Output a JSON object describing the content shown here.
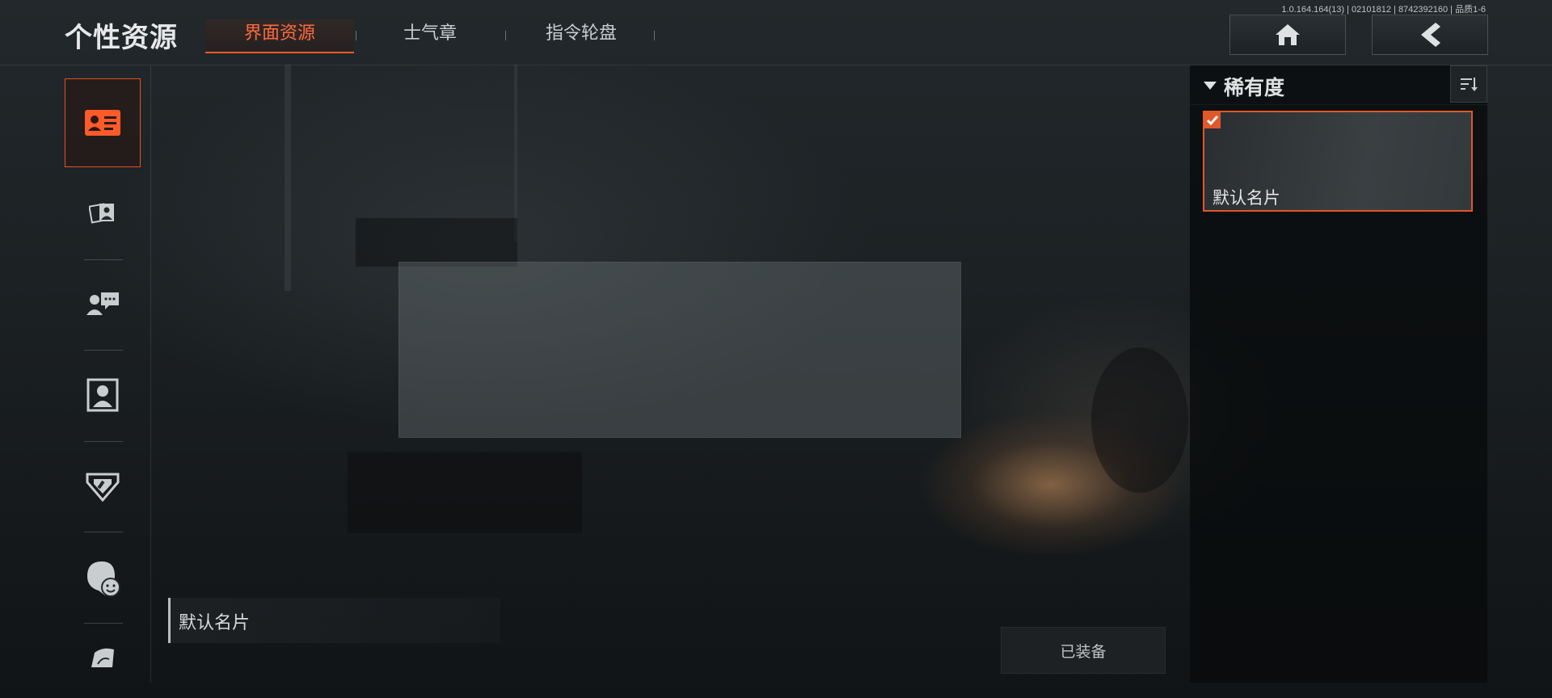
{
  "header": {
    "title": "个性资源",
    "tabs": [
      {
        "label": "界面资源",
        "active": true
      },
      {
        "label": "士气章",
        "active": false
      },
      {
        "label": "指令轮盘",
        "active": false
      }
    ],
    "version": "1.0.164.164(13) | 02101812 | 8742392160 | 品质1-6",
    "home_icon": "home-icon",
    "back_icon": "back-icon"
  },
  "sidebar": {
    "items": [
      {
        "name": "name-card",
        "icon": "id-card-icon",
        "active": true
      },
      {
        "name": "photo-frames",
        "icon": "photos-icon",
        "active": false
      },
      {
        "name": "chat-bubbles",
        "icon": "chat-icon",
        "active": false
      },
      {
        "name": "portrait",
        "icon": "portrait-icon",
        "active": false
      },
      {
        "name": "badge",
        "icon": "badge-icon",
        "active": false
      },
      {
        "name": "emote",
        "icon": "emote-icon",
        "active": false
      },
      {
        "name": "more",
        "icon": "emblem-icon",
        "active": false
      }
    ]
  },
  "preview": {
    "card_name": "默认名片",
    "equip_status": "已装备"
  },
  "filter_panel": {
    "rarity_label": "稀有度",
    "sort_icon": "sort-icon",
    "items": [
      {
        "name": "默认名片",
        "selected": true
      }
    ]
  },
  "colors": {
    "accent": "#e0572a",
    "active_tab_text": "#ff6a3d"
  }
}
